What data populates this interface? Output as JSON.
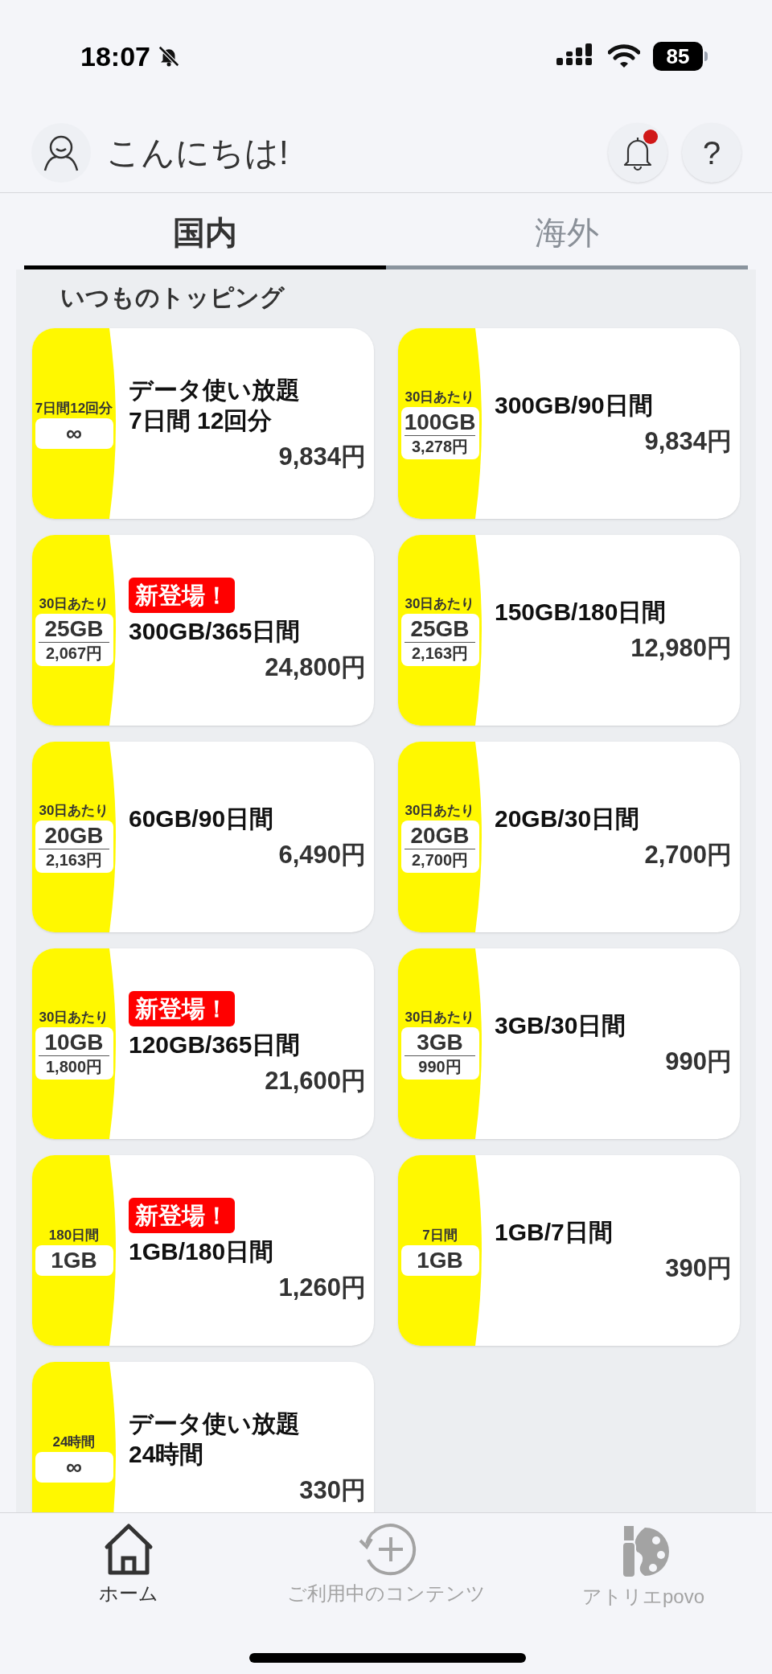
{
  "status_bar": {
    "time": "18:07",
    "silent": true,
    "battery": "85"
  },
  "header": {
    "greeting": "こんにちは!",
    "notification_dot": true,
    "help": "?"
  },
  "tabs": [
    {
      "label": "国内",
      "selected": true
    },
    {
      "label": "海外",
      "selected": false
    }
  ],
  "section_title": "いつものトッピング",
  "plans": [
    {
      "badge_period": "7日間12回分",
      "badge_amount": "∞",
      "title_lines": [
        "データ使い放題",
        "7日間 12回分"
      ],
      "price": "9,834円"
    },
    {
      "badge_period": "30日あたり",
      "badge_amount": "100GB",
      "badge_price": "3,278円",
      "title_lines": [
        "300GB/90日間"
      ],
      "price": "9,834円"
    },
    {
      "badge_period": "30日あたり",
      "badge_amount": "25GB",
      "badge_price": "2,067円",
      "new_label": "新登場！",
      "title_lines": [
        "300GB/365日間"
      ],
      "price": "24,800円"
    },
    {
      "badge_period": "30日あたり",
      "badge_amount": "25GB",
      "badge_price": "2,163円",
      "title_lines": [
        "150GB/180日間"
      ],
      "price": "12,980円"
    },
    {
      "badge_period": "30日あたり",
      "badge_amount": "20GB",
      "badge_price": "2,163円",
      "title_lines": [
        "60GB/90日間"
      ],
      "price": "6,490円"
    },
    {
      "badge_period": "30日あたり",
      "badge_amount": "20GB",
      "badge_price": "2,700円",
      "title_lines": [
        "20GB/30日間"
      ],
      "price": "2,700円"
    },
    {
      "badge_period": "30日あたり",
      "badge_amount": "10GB",
      "badge_price": "1,800円",
      "new_label": "新登場！",
      "title_lines": [
        "120GB/365日間"
      ],
      "price": "21,600円"
    },
    {
      "badge_period": "30日あたり",
      "badge_amount": "3GB",
      "badge_price": "990円",
      "title_lines": [
        "3GB/30日間"
      ],
      "price": "990円"
    },
    {
      "badge_period": "180日間",
      "badge_amount": "1GB",
      "new_label": "新登場！",
      "title_lines": [
        "1GB/180日間"
      ],
      "price": "1,260円"
    },
    {
      "badge_period": "7日間",
      "badge_amount": "1GB",
      "title_lines": [
        "1GB/7日間"
      ],
      "price": "390円"
    },
    {
      "badge_period": "24時間",
      "badge_amount": "∞",
      "title_lines": [
        "データ使い放題",
        "24時間"
      ],
      "price": "330円"
    }
  ],
  "nav": [
    {
      "kind": "home",
      "label": "ホーム",
      "selected": true
    },
    {
      "kind": "contents",
      "label": "ご利用中のコンテンツ",
      "selected": false
    },
    {
      "kind": "atelier",
      "label": "アトリエpovo",
      "selected": false
    }
  ]
}
